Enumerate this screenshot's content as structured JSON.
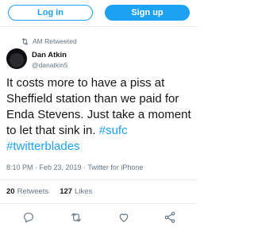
{
  "header": {
    "login_label": "Log in",
    "signup_label": "Sign up"
  },
  "retweet_context": {
    "text": "AM Retweeted",
    "icon": "retweet-icon"
  },
  "tweet": {
    "author_name": "Dan Atkin",
    "author_handle": "@danatkin5",
    "body": "It costs more to have a piss at Sheffield station than we paid for Enda Stevens. Just take a moment to let that sink in.",
    "hashtags": [
      "#sufc",
      "#twitterblades"
    ],
    "timestamp": "8:10 PM · Feb 23, 2019 · Twitter for iPhone",
    "retweets_count": "20",
    "retweets_label": "Retweets",
    "likes_count": "127",
    "likes_label": "Likes"
  },
  "actions": [
    "reply-icon",
    "retweet-icon",
    "like-icon",
    "share-icon"
  ],
  "colors": {
    "accent": "#1da1f2",
    "text": "#14171a",
    "muted": "#657786",
    "border": "#e6ecf0"
  }
}
